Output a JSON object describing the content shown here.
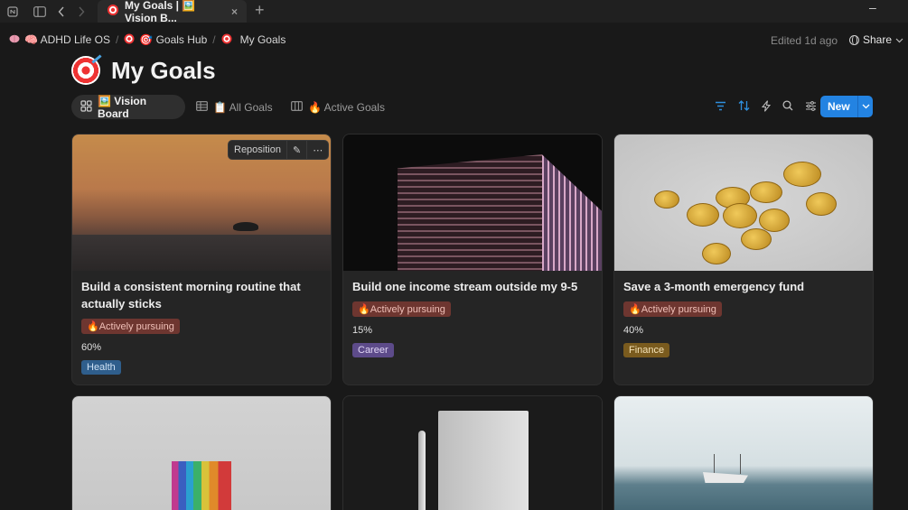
{
  "titlebar": {
    "tab_title": "My Goals | 🖼️ Vision B...",
    "tab_close": "×",
    "new_tab": "+",
    "minimize": "–"
  },
  "breadcrumb": {
    "items": [
      {
        "icon": "brain-icon",
        "label": "🧠 ADHD Life OS"
      },
      {
        "icon": "target-icon",
        "label": "🎯 Goals Hub"
      },
      {
        "icon": "target-icon",
        "label": "My Goals"
      }
    ],
    "separator": "/",
    "edited": "Edited 1d ago",
    "share_label": "Share"
  },
  "page": {
    "title": "My Goals"
  },
  "views": {
    "tabs": [
      {
        "label": "🖼️ Vision Board",
        "active": true
      },
      {
        "label": "📋 All Goals",
        "active": false
      },
      {
        "label": "🔥 Active Goals",
        "active": false
      }
    ],
    "new_label": "New"
  },
  "cards": [
    {
      "title": "Build a consistent morning routine that actually sticks",
      "status": "🔥Actively pursuing",
      "progress": "60%",
      "area": "Health",
      "area_color": "#2f5e8c",
      "menu": {
        "reposition": "Reposition",
        "edit": "✎",
        "more": "⋯"
      }
    },
    {
      "title": "Build one income stream outside my 9-5",
      "status": "🔥Actively pursuing",
      "progress": "15%",
      "area": "Career",
      "area_color": "#5d4b8a"
    },
    {
      "title": "Save a 3-month emergency fund",
      "status": "🔥Actively pursuing",
      "progress": "40%",
      "area": "Finance",
      "area_color": "#7a5b1e"
    }
  ],
  "colors": {
    "accent": "#2383e2",
    "background": "#191919",
    "card": "#252525",
    "status_tag": "#6e3630"
  }
}
